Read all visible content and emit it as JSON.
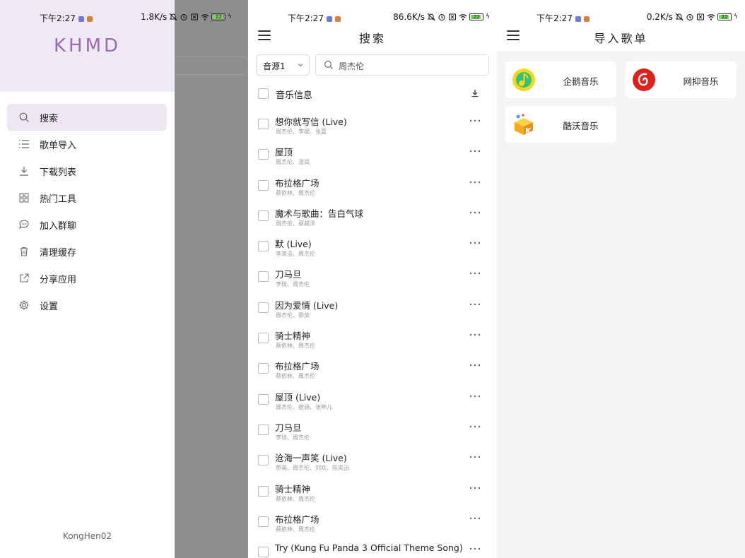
{
  "panel1": {
    "status": {
      "time": "下午2:27",
      "speed": "1.8K/s",
      "battery": "22"
    },
    "brand": "KHMD",
    "menu": [
      {
        "label": "搜索",
        "icon": "search-icon"
      },
      {
        "label": "歌单导入",
        "icon": "list-icon"
      },
      {
        "label": "下载列表",
        "icon": "download-icon"
      },
      {
        "label": "热门工具",
        "icon": "grid-icon"
      },
      {
        "label": "加入群聊",
        "icon": "chat-icon"
      },
      {
        "label": "清理缓存",
        "icon": "trash-icon"
      },
      {
        "label": "分享应用",
        "icon": "share-icon"
      },
      {
        "label": "设置",
        "icon": "gear-icon"
      }
    ],
    "footer": "KongHen02"
  },
  "panel2": {
    "status": {
      "time": "下午2:27",
      "speed": "86.6K/s",
      "battery": "22"
    },
    "title": "搜索",
    "source": "音源1",
    "search_value": "周杰伦",
    "list_header": "音乐信息",
    "songs": [
      {
        "title": "想你就写信 (Live)",
        "artist": "周杰伦、李斌、张嘉"
      },
      {
        "title": "屋顶",
        "artist": "周杰伦、温岚"
      },
      {
        "title": "布拉格广场",
        "artist": "蔡依林、周杰伦"
      },
      {
        "title": "魔术与歌曲：告白气球",
        "artist": "周杰伦、蔡威泽"
      },
      {
        "title": "默 (Live)",
        "artist": "李荣浩、周杰伦"
      },
      {
        "title": "刀马旦",
        "artist": "李玟、周杰伦"
      },
      {
        "title": "因为爱情 (Live)",
        "artist": "周杰伦、那英"
      },
      {
        "title": "骑士精神",
        "artist": "蔡依林、周杰伦"
      },
      {
        "title": "布拉格广场",
        "artist": "蔡依林、周杰伦"
      },
      {
        "title": "屋顶 (Live)",
        "artist": "周杰伦、宿涵、张神儿"
      },
      {
        "title": "刀马旦",
        "artist": "李玟、周杰伦"
      },
      {
        "title": "沧海一声笑 (Live)",
        "artist": "那英、周杰伦、刘欢、陈奕迅"
      },
      {
        "title": "骑士精神",
        "artist": "蔡依林、周杰伦"
      },
      {
        "title": "布拉格广场",
        "artist": "蔡依林、周杰伦"
      },
      {
        "title": "Try (Kung Fu Panda 3 Official Theme Song)",
        "artist": ""
      }
    ]
  },
  "panel3": {
    "status": {
      "time": "下午2:27",
      "speed": "0.2K/s",
      "battery": "22"
    },
    "title": "导入歌单",
    "sources": [
      {
        "label": "企鹅音乐",
        "icon": "qq-music-icon"
      },
      {
        "label": "网抑音乐",
        "icon": "netease-music-icon"
      },
      {
        "label": "酷沃音乐",
        "icon": "kuwo-music-icon"
      }
    ]
  },
  "colors": {
    "accent": "#9a6bb0",
    "drawer_head": "#efe8f5",
    "active_item": "#ece7f0",
    "scrim": "#8e8e8e"
  }
}
